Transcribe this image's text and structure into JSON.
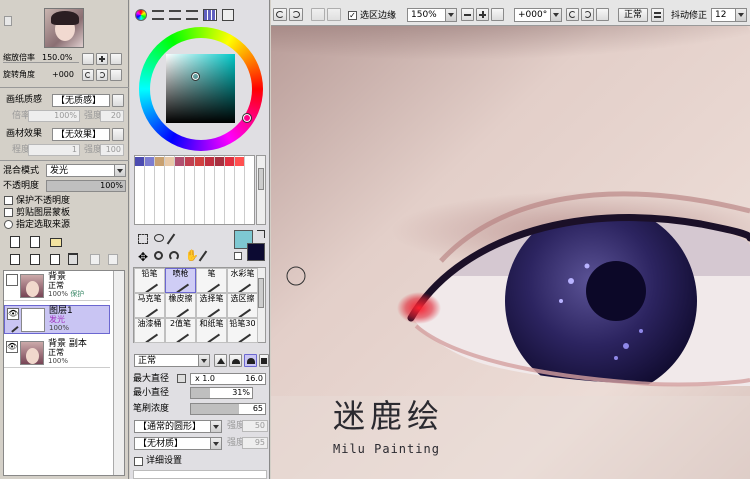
{
  "navigator": {
    "zoom_label": "缩放倍率",
    "zoom_value": "150.0%",
    "rotate_label": "旋转角度",
    "rotate_value": "+000"
  },
  "paper": {
    "texture_label": "画纸质感",
    "texture_value": "【无质感】",
    "scale_label": "倍率",
    "scale_value": "100%",
    "strength_label": "强度",
    "strength_value": "20",
    "effect_label": "画材效果",
    "effect_value": "【无效果】",
    "degree_label": "程度",
    "degree_value": "1",
    "effect_strength_label": "强度",
    "effect_strength_value": "100"
  },
  "layer_props": {
    "blend_label": "混合模式",
    "blend_value": "发光",
    "opacity_label": "不透明度",
    "opacity_value": "100%",
    "opacity_fraction": 1.0,
    "checks": [
      {
        "label": "保护不透明度"
      },
      {
        "label": "剪贴图层蒙板"
      },
      {
        "label": "指定选取来源"
      }
    ]
  },
  "layers": [
    {
      "name": "背景",
      "mode": "正常",
      "opacity": "100%",
      "extra": "保护",
      "selected": false
    },
    {
      "name": "图层1",
      "mode": "发光",
      "opacity": "100%",
      "extra": "",
      "selected": true
    },
    {
      "name": "背景 副本",
      "mode": "正常",
      "opacity": "100%",
      "extra": "",
      "selected": false
    }
  ],
  "brushes": {
    "row1": [
      "铅笔",
      "喷枪",
      "笔",
      "水彩笔"
    ],
    "row2": [
      "马克笔",
      "橡皮擦",
      "选择笔",
      "选区擦"
    ],
    "row3": [
      "油漆桶",
      "2值笔",
      "和纸笔",
      "铅笔30"
    ]
  },
  "brush_settings": {
    "mode_value": "正常",
    "max_size_label": "最大直径",
    "max_size_mult": "x 1.0",
    "max_size_value": "16.0",
    "min_size_label": "最小直径",
    "min_size_value": "31%",
    "min_size_fraction": 0.31,
    "density_label": "笔刷浓度",
    "density_value": "65",
    "density_fraction": 0.65,
    "shape_value": "【通常的圆形】",
    "shape_strength_label": "强度",
    "shape_strength_value": "50",
    "texture_value": "【无材质】",
    "texture_strength_label": "强度",
    "texture_strength_value": "95",
    "detail_label": "详细设置"
  },
  "toolbar": {
    "selection_edge_label": "选区边缘",
    "zoom_value": "150%",
    "rotate_value": "+000°",
    "mode_value": "正常",
    "stabilizer_label": "抖动修正",
    "stabilizer_value": "12"
  },
  "canvas_text": {
    "title_cn": "迷鹿绘",
    "title_en": "Milu Painting"
  },
  "colors": {
    "main": "#7ec8d2",
    "sub": "#0c0a32",
    "accent": "#6b67d0"
  },
  "palette": [
    "#4b4bb0",
    "#7c7cd0",
    "#c8a070",
    "#e8c9a8",
    "#b05070",
    "#c04050",
    "#d04040",
    "#c03040",
    "#a83040",
    "#e03040",
    "#ff5050"
  ]
}
